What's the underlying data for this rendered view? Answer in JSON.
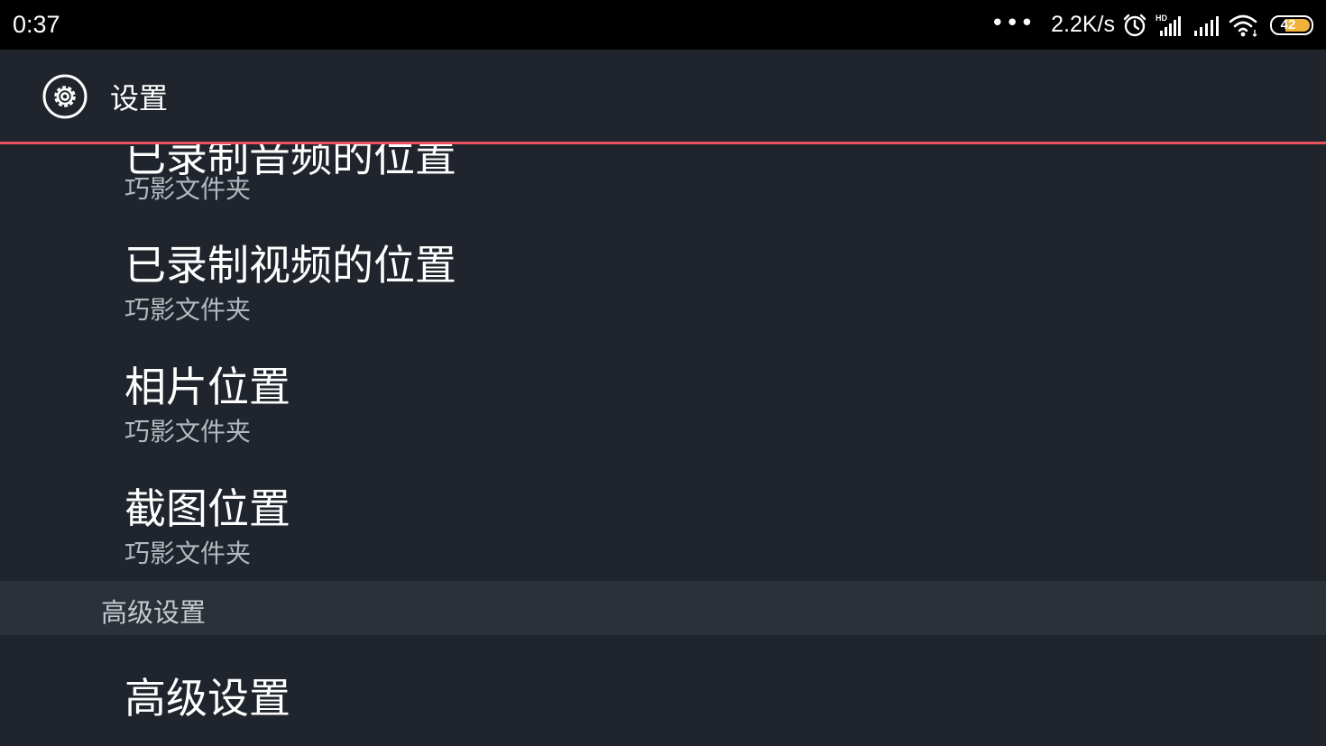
{
  "status_bar": {
    "time": "0:37",
    "dots": "•••",
    "net_speed": "2.2K/s",
    "hd_label": "HD",
    "battery_level": 42,
    "battery_color": "#f0b23a",
    "icons": [
      "alarm-icon",
      "hd-signal-icon",
      "signal-icon",
      "wifi-icon",
      "battery-icon"
    ]
  },
  "app_bar": {
    "icon": "gear-icon",
    "title": "设置",
    "accent_color": "#e8505b"
  },
  "preferences": [
    {
      "title": "已录制音频的位置",
      "summary": "巧影文件夹"
    },
    {
      "title": "已录制视频的位置",
      "summary": "巧影文件夹"
    },
    {
      "title": "相片位置",
      "summary": "巧影文件夹"
    },
    {
      "title": "截图位置",
      "summary": "巧影文件夹"
    }
  ],
  "category": {
    "label": "高级设置"
  },
  "advanced_item": {
    "title": "高级设置"
  }
}
